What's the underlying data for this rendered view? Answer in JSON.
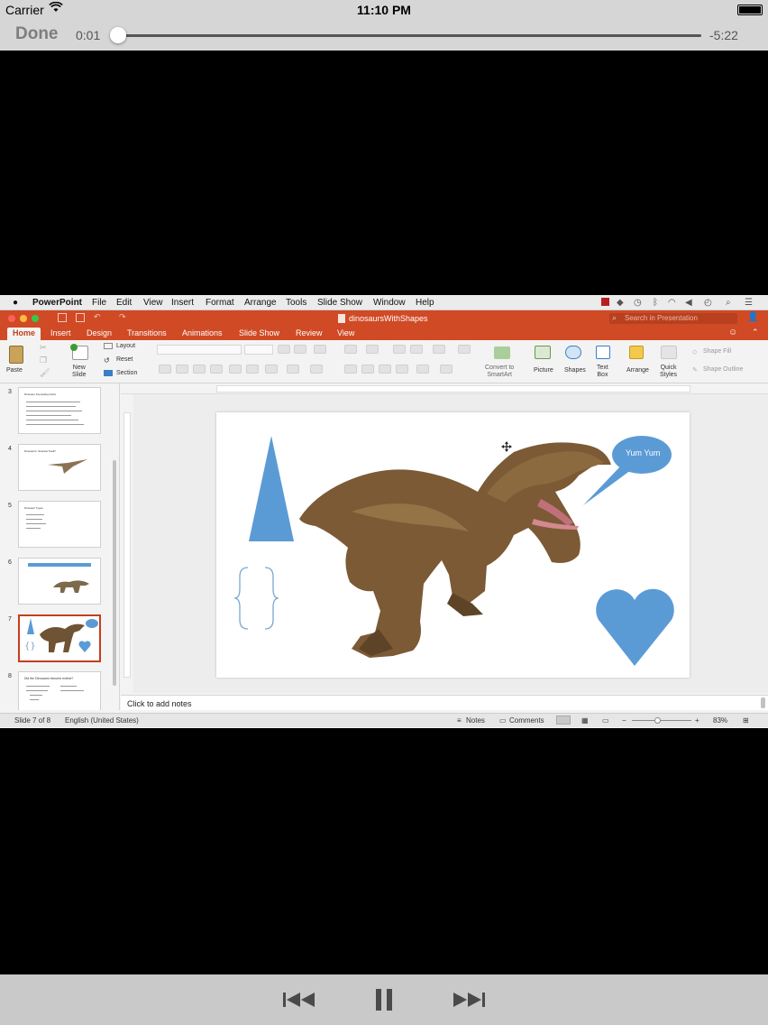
{
  "status_bar": {
    "carrier": "Carrier",
    "time": "11:10 PM"
  },
  "player": {
    "done_label": "Done",
    "elapsed": "0:01",
    "remaining": "-5:22",
    "progress_fraction": 0.003,
    "controls": [
      "rewind-icon",
      "pause-icon",
      "fast-forward-icon"
    ]
  },
  "mac_menubar": {
    "app": "PowerPoint",
    "menus": [
      "File",
      "Edit",
      "View",
      "Insert",
      "Format",
      "Arrange",
      "Tools",
      "Slide Show",
      "Window",
      "Help"
    ]
  },
  "window": {
    "title": "dinosaursWithShapes",
    "search_placeholder": "Search in Presentation"
  },
  "ribbon": {
    "tabs": [
      "Home",
      "Insert",
      "Design",
      "Transitions",
      "Animations",
      "Slide Show",
      "Review",
      "View"
    ],
    "active_tab": "Home",
    "paste_label": "Paste",
    "new_slide_label": "New\nSlide",
    "layout_label": "Layout",
    "reset_label": "Reset",
    "section_label": "Section",
    "convert_label": "Convert to\nSmartArt",
    "picture_label": "Picture",
    "shapes_label": "Shapes",
    "textbox_label": "Text\nBox",
    "arrange_label": "Arrange",
    "quick_styles_label": "Quick\nStyles",
    "shape_fill_label": "Shape Fill",
    "shape_outline_label": "Shape Outline"
  },
  "thumbnails": [
    {
      "num": "3",
      "title": "Dinosaur Interesting Facts"
    },
    {
      "num": "4",
      "title": "Dinosaurs: Scariest Teeth!"
    },
    {
      "num": "5",
      "title": "Dinosaur Types"
    },
    {
      "num": "6",
      "title": ""
    },
    {
      "num": "7",
      "title": ""
    },
    {
      "num": "8",
      "title": "Did the Dinosaurs become extinct?"
    }
  ],
  "slide": {
    "callout_text": "Yum Yum",
    "shape_color": "#5b9bd5"
  },
  "notes_placeholder": "Click to add notes",
  "statusbar": {
    "slide_info": "Slide 7 of 8",
    "language": "English (United States)",
    "notes_label": "Notes",
    "comments_label": "Comments",
    "zoom": "83%"
  },
  "colors": {
    "accent": "#d04a25",
    "shape_blue": "#5b9bd5"
  }
}
